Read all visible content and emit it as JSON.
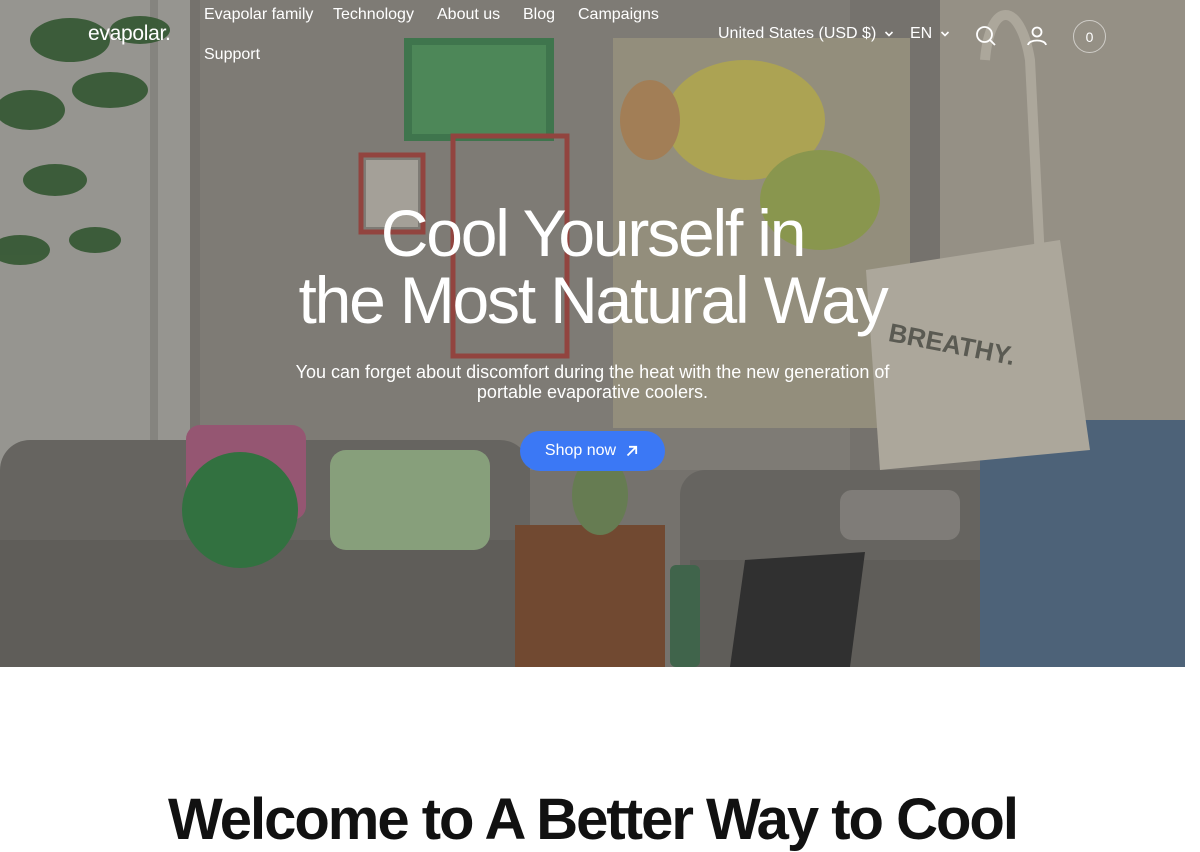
{
  "brand": {
    "logo_text": "evapolar."
  },
  "nav": {
    "items": [
      {
        "label": "Evapolar family"
      },
      {
        "label": "Technology"
      },
      {
        "label": "About us"
      },
      {
        "label": "Blog"
      },
      {
        "label": "Campaigns"
      },
      {
        "label": "Support"
      }
    ]
  },
  "header_tools": {
    "country_selector": "United States (USD $)",
    "language_selector": "EN",
    "search_icon": "search-icon",
    "account_icon": "user-icon",
    "cart_count": "0"
  },
  "hero": {
    "title_line_1": "Cool Yourself in",
    "title_line_2": "the Most Natural Way",
    "subtitle": "You can forget about discomfort during the heat with the new generation of portable evaporative coolers.",
    "cta_label": "Shop now",
    "cta_icon": "arrow-up-right-icon",
    "bag_print": "BREATHY."
  },
  "next_section": {
    "heading_partial": "Welcome to A Better Way to Cool"
  },
  "colors": {
    "cta_blue": "#3b78f5",
    "text_white": "#ffffff"
  }
}
